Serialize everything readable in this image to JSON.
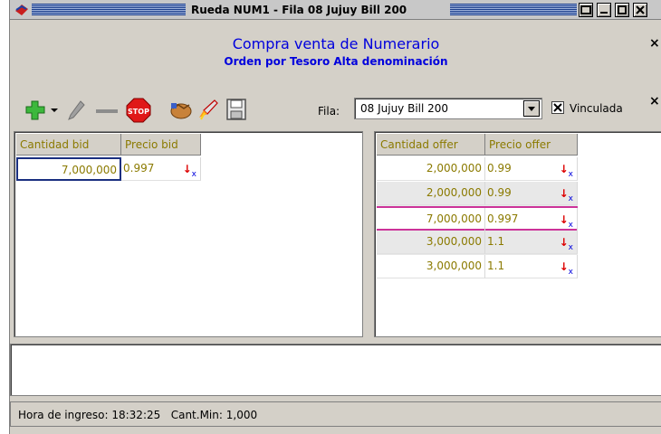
{
  "window": {
    "title": "Rueda NUM1 - Fila 08 Jujuy Bill 200",
    "minimize_label": "_",
    "restore_label": "□",
    "close_label": "x"
  },
  "header": {
    "title": "Compra venta de Numerario",
    "subtitle": "Orden por Tesoro Alta denominación",
    "close_label": "×"
  },
  "toolbar": {
    "icons": [
      "add-icon",
      "dropdown-arrow-icon",
      "edit-pencil-icon",
      "remove-icon",
      "stop-icon",
      "handshake-icon",
      "rocket-icon",
      "save-icon"
    ],
    "stop_label": "STOP",
    "close_label": "×",
    "fila_label": "Fila:",
    "fila_value": "08 Jujuy Bill 200",
    "vinculada_checked": true,
    "vinculada_label": "Vinculada"
  },
  "bid_table": {
    "columns": [
      "Cantidad bid",
      "Precio bid"
    ],
    "rows": [
      {
        "cantidad": "7,000,000",
        "precio": "0.997"
      }
    ]
  },
  "offer_table": {
    "columns": [
      "Cantidad offer",
      "Precio offer"
    ],
    "rows": [
      {
        "cantidad": "2,000,000",
        "precio": "0.99"
      },
      {
        "cantidad": "2,000,000",
        "precio": "0.99"
      },
      {
        "cantidad": "7,000,000",
        "precio": "0.997",
        "highlight": true
      },
      {
        "cantidad": "3,000,000",
        "precio": "1.1"
      },
      {
        "cantidad": "3,000,000",
        "precio": "1.1"
      }
    ]
  },
  "row_action": {
    "arrow": "↓",
    "x": "x"
  },
  "colors": {
    "title_blue": "#0000dd",
    "cell_text": "#8b7a00",
    "highlight_border": "#cc3399",
    "row_gray": "#e8e8e8"
  },
  "status": {
    "hora_label": "Hora de ingreso:",
    "hora_value": "18:32:25",
    "cantmin_label": "Cant.Min:",
    "cantmin_value": "1,000"
  }
}
